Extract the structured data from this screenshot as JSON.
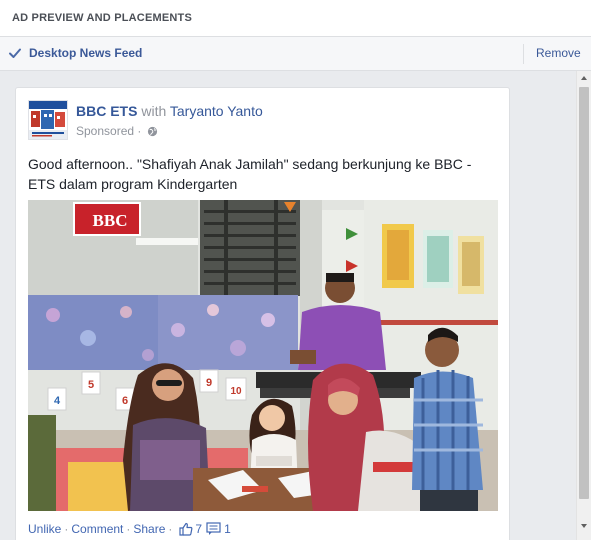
{
  "header": {
    "title": "AD PREVIEW AND PLACEMENTS"
  },
  "placement": {
    "label": "Desktop News Feed",
    "remove_label": "Remove"
  },
  "post": {
    "page_name": "BBC ETS",
    "with_text": "with",
    "tagged_name": "Taryanto Yanto",
    "sponsored": "Sponsored",
    "separator": "·",
    "text": "Good afternoon.. \"Shafiyah Anak Jamilah\" sedang berkunjung ke BBC - ETS dalam program Kindergarten",
    "banner_logo": "BBC",
    "wall_numbers": [
      "5",
      "4",
      "6",
      "9",
      "10"
    ],
    "actions": {
      "unlike": "Unlike",
      "comment": "Comment",
      "share": "Share",
      "like_count": "7",
      "comment_count": "1"
    }
  },
  "icons": {
    "check": "check-icon",
    "globe": "globe-icon",
    "like": "thumbs-up-icon",
    "comment": "comment-icon"
  },
  "colors": {
    "link_blue": "#365899",
    "accent_blue": "#3b5998",
    "muted_gray": "#90949c",
    "text_dark": "#1d2129",
    "feed_bg": "#e9ebee"
  }
}
